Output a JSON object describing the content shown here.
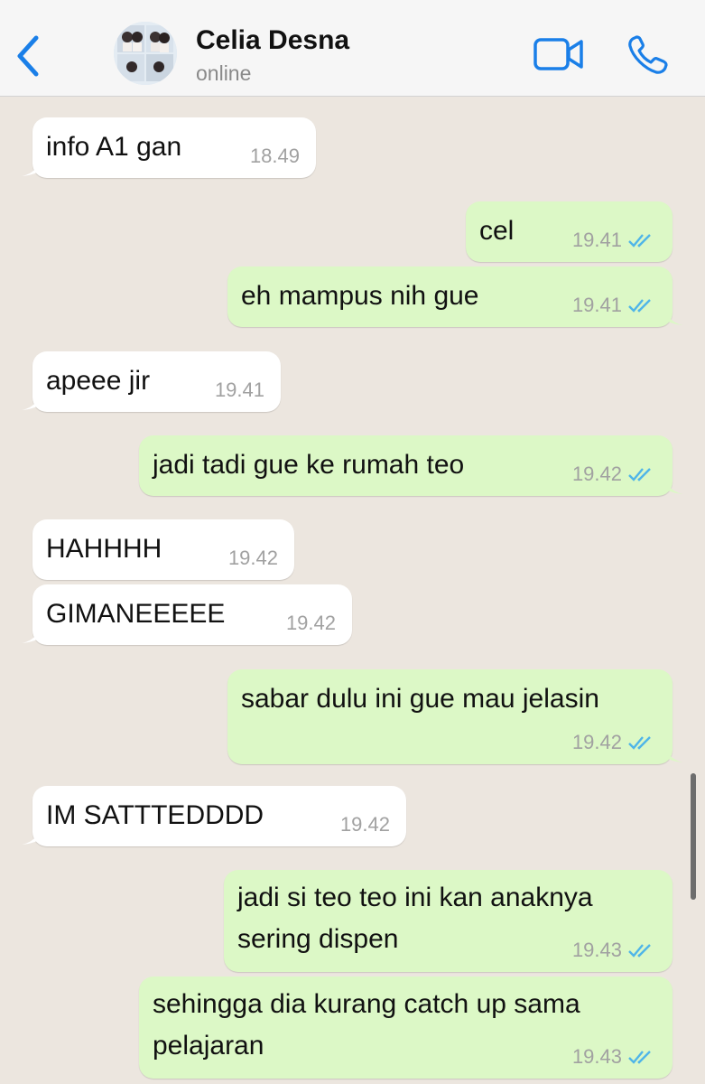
{
  "header": {
    "contact_name": "Celia Desna",
    "status": "online"
  },
  "icons": {
    "back": "chevron-left",
    "video": "video-camera",
    "call": "phone",
    "read": "double-check"
  },
  "colors": {
    "accent": "#1a7fe8",
    "incoming_bubble": "#ffffff",
    "outgoing_bubble": "#dcf8c6",
    "background": "#ece6df",
    "read_ticks": "#4fb5e8"
  },
  "messages": [
    {
      "dir": "in",
      "text": "info A1 gan",
      "time": "18.49"
    },
    {
      "dir": "out",
      "text": "cel",
      "time": "19.41"
    },
    {
      "dir": "out",
      "text": "eh mampus nih gue",
      "time": "19.41"
    },
    {
      "dir": "in",
      "text": "apeee jir",
      "time": "19.41"
    },
    {
      "dir": "out",
      "text": "jadi tadi gue ke rumah teo",
      "time": "19.42"
    },
    {
      "dir": "in",
      "text": "HAHHHH",
      "time": "19.42"
    },
    {
      "dir": "in",
      "text": "GIMANEEEEE",
      "time": "19.42"
    },
    {
      "dir": "out",
      "text": "sabar dulu ini gue mau jelasin",
      "time": "19.42"
    },
    {
      "dir": "in",
      "text": "IM SATTTEDDDD",
      "time": "19.42"
    },
    {
      "dir": "out",
      "lines": [
        "jadi si teo teo ini kan anaknya",
        "sering dispen"
      ],
      "time": "19.43"
    },
    {
      "dir": "out",
      "lines": [
        "sehingga dia kurang catch up sama",
        "pelajaran"
      ],
      "time": "19.43"
    }
  ]
}
